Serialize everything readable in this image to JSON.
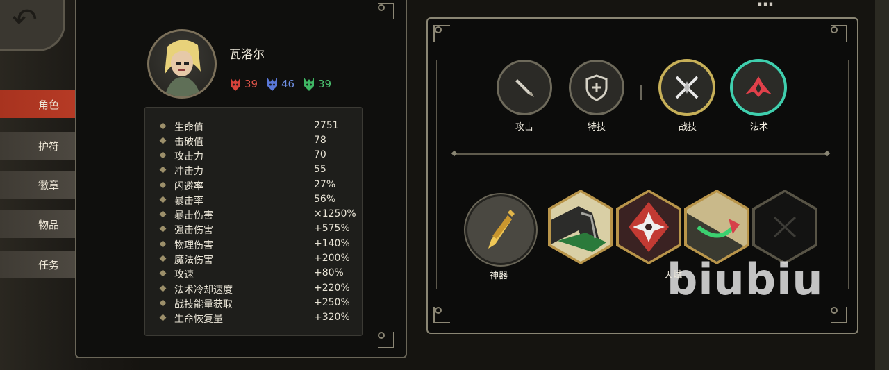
{
  "header": {
    "title_fragment": "…"
  },
  "tabs": [
    {
      "label": "角色",
      "active": true
    },
    {
      "label": "护符",
      "active": false
    },
    {
      "label": "徽章",
      "active": false
    },
    {
      "label": "物品",
      "active": false
    },
    {
      "label": "任务",
      "active": false
    }
  ],
  "character": {
    "name": "瓦洛尔",
    "resources": [
      {
        "icon": "red-mask-icon",
        "value": "39",
        "color": "#e0554a"
      },
      {
        "icon": "blue-mask-icon",
        "value": "46",
        "color": "#6f8fe3"
      },
      {
        "icon": "green-mask-icon",
        "value": "39",
        "color": "#4cc672"
      }
    ]
  },
  "stats": [
    {
      "label": "生命值",
      "value": "2751"
    },
    {
      "label": "击破值",
      "value": "78"
    },
    {
      "label": "攻击力",
      "value": "70"
    },
    {
      "label": "冲击力",
      "value": "55"
    },
    {
      "label": "闪避率",
      "value": "27%"
    },
    {
      "label": "暴击率",
      "value": "56%"
    },
    {
      "label": "暴击伤害",
      "value": "×1250%"
    },
    {
      "label": "强击伤害",
      "value": "+575%"
    },
    {
      "label": "物理伤害",
      "value": "+140%"
    },
    {
      "label": "魔法伤害",
      "value": "+200%"
    },
    {
      "label": "攻速",
      "value": "+80%"
    },
    {
      "label": "法术冷却速度",
      "value": "+220%"
    },
    {
      "label": "战技能量获取",
      "value": "+250%"
    },
    {
      "label": "生命恢复量",
      "value": "+320%"
    }
  ],
  "skills": [
    {
      "label": "攻击",
      "icon": "sword-icon"
    },
    {
      "label": "特技",
      "icon": "shield-icon"
    },
    {
      "label": "战技",
      "icon": "crossed-blades-icon"
    },
    {
      "label": "法术",
      "icon": "flame-spell-icon"
    }
  ],
  "relic": {
    "label": "神器",
    "icon": "dagger-icon"
  },
  "talents": {
    "label": "天赋",
    "slots": [
      {
        "icon": "claw-talent-icon",
        "filled": true
      },
      {
        "icon": "shuriken-talent-icon",
        "filled": true
      },
      {
        "icon": "arrow-talent-icon",
        "filled": true
      },
      {
        "icon": "empty-slot-icon",
        "filled": false
      }
    ]
  },
  "watermark": "biubiu"
}
